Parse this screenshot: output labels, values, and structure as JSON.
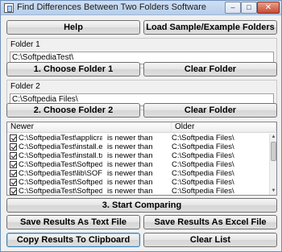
{
  "window": {
    "title": "Find Differences Between Two Folders Software"
  },
  "titlebar_buttons": {
    "minimize": "–",
    "maximize": "□",
    "close": "✕"
  },
  "buttons": {
    "help": "Help",
    "load_sample": "Load Sample/Example Folders",
    "choose_folder_1": "1. Choose Folder 1",
    "clear_folder_1": "Clear Folder",
    "choose_folder_2": "2. Choose Folder 2",
    "clear_folder_2": "Clear Folder",
    "start_comparing": "3. Start Comparing",
    "save_text": "Save Results As Text File",
    "save_excel": "Save Results As Excel File",
    "copy_clipboard": "Copy Results To Clipboard",
    "clear_list": "Clear List"
  },
  "folder1": {
    "label": "Folder 1",
    "path": "C:\\SoftpediaTest\\"
  },
  "folder2": {
    "label": "Folder 2",
    "path": "C:\\Softpedia Files\\"
  },
  "results": {
    "columns": {
      "newer": "Newer",
      "older": "Older"
    },
    "rows": [
      {
        "checked": true,
        "newer": "C:\\SoftpediaTest\\applicra...",
        "status": "is newer than",
        "older": "C:\\Softpedia Files\\"
      },
      {
        "checked": true,
        "newer": "C:\\SoftpediaTest\\install.e...",
        "status": "is newer than",
        "older": "C:\\Softpedia Files\\"
      },
      {
        "checked": true,
        "newer": "C:\\SoftpediaTest\\install.txt",
        "status": "is newer than",
        "older": "C:\\Softpedia Files\\"
      },
      {
        "checked": true,
        "newer": "C:\\SoftpediaTest\\Softped...",
        "status": "is newer than",
        "older": "C:\\Softpedia Files\\"
      },
      {
        "checked": true,
        "newer": "C:\\SoftpediaTest\\lib\\SOFT...",
        "status": "is newer than",
        "older": "C:\\Softpedia Files\\"
      },
      {
        "checked": true,
        "newer": "C:\\SoftpediaTest\\Softped...",
        "status": "is newer than",
        "older": "C:\\Softpedia Files\\"
      },
      {
        "checked": true,
        "newer": "C:\\SoftpediaTest\\Softped...",
        "status": "is newer than",
        "older": "C:\\Softpedia Files\\"
      }
    ]
  }
}
